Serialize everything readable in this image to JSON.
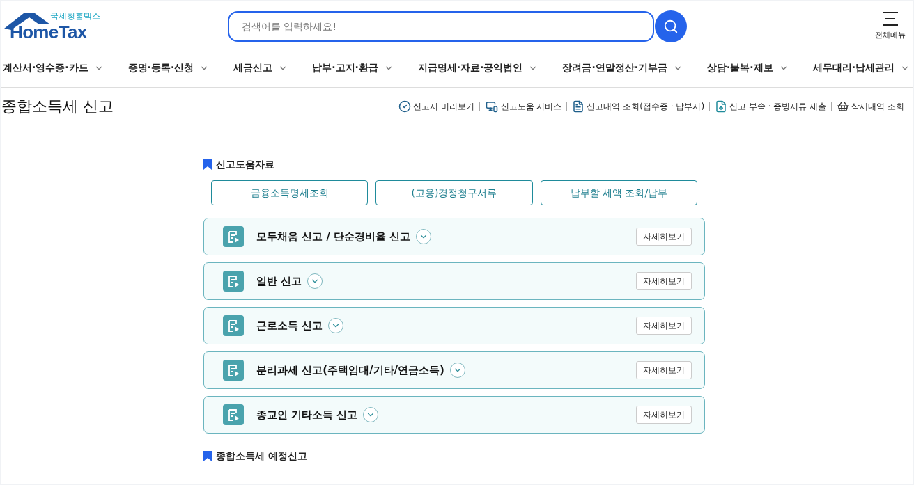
{
  "header": {
    "logo_caption": "국세청홈택스",
    "logo_text": "HomeTax",
    "search": {
      "placeholder": "검색어를 입력하세요!"
    },
    "menu_label": "전체메뉴"
  },
  "nav": [
    {
      "label": "계산서·영수증·카드"
    },
    {
      "label": "증명·등록·신청"
    },
    {
      "label": "세금신고"
    },
    {
      "label": "납부·고지·환급"
    },
    {
      "label": "지급명세·자료·공익법인"
    },
    {
      "label": "장려금·연말정산·기부금"
    },
    {
      "label": "상담·불복·제보"
    },
    {
      "label": "세무대리·납세관리"
    }
  ],
  "page_title": "종합소득세 신고",
  "tools": [
    {
      "kind": "preview",
      "label": "신고서 미리보기"
    },
    {
      "kind": "help",
      "label": "신고도움 서비스"
    },
    {
      "kind": "history",
      "label": "신고내역 조회(접수증 · 납부서)"
    },
    {
      "kind": "upload",
      "label": "신고 부속 · 증빙서류 제출"
    },
    {
      "kind": "trash",
      "label": "삭제내역 조회"
    }
  ],
  "help_section": {
    "title": "신고도움자료",
    "buttons": [
      "금융소득명세조회",
      "(고용)경정청구서류",
      "납부할 세액 조회/납부"
    ]
  },
  "filings": [
    {
      "title": "모두채움 신고 / 단순경비율 신고",
      "detail_button": "자세히보기"
    },
    {
      "title": "일반 신고",
      "detail_button": "자세히보기"
    },
    {
      "title": "근로소득 신고",
      "detail_button": "자세히보기"
    },
    {
      "title": "분리과세 신고(주택임대/기타/연금소득)",
      "detail_button": "자세히보기"
    },
    {
      "title": "종교인 기타소득 신고",
      "detail_button": "자세히보기"
    }
  ],
  "next_section": {
    "title": "종합소득세 예정신고"
  }
}
